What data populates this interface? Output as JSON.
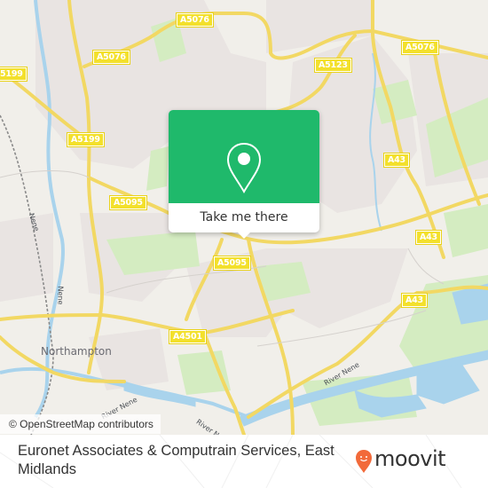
{
  "map": {
    "road_labels": [
      {
        "id": "a5076-top",
        "text": "A5076"
      },
      {
        "id": "a5076-left",
        "text": "A5076"
      },
      {
        "id": "a5199-edge",
        "text": "5199"
      },
      {
        "id": "a5199",
        "text": "A5199"
      },
      {
        "id": "a5076-right",
        "text": "A5076"
      },
      {
        "id": "a5123",
        "text": "A5123"
      },
      {
        "id": "a43-top",
        "text": "A43"
      },
      {
        "id": "a43-mid",
        "text": "A43"
      },
      {
        "id": "a43-low",
        "text": "A43"
      },
      {
        "id": "a5095-left",
        "text": "A5095"
      },
      {
        "id": "a5095-center",
        "text": "A5095"
      },
      {
        "id": "a4501",
        "text": "A4501"
      }
    ],
    "place_labels": {
      "northampton": "Northampton"
    },
    "river_labels": {
      "nene_vertical_1": "Nene",
      "nene_vertical_2": "Nene",
      "river_nene_1": "River Nene",
      "river_nene_2": "River Nene",
      "river_nene_3": "River Nene"
    },
    "attribution": "© OpenStreetMap contributors"
  },
  "popup": {
    "icon": "location-pin-icon",
    "button_label": "Take me there",
    "color": "#1fb96b"
  },
  "footer": {
    "title": "Euronet Associates & Computrain Services, East Midlands",
    "logo_text": "moovit",
    "logo_color": "#f26a3a"
  }
}
